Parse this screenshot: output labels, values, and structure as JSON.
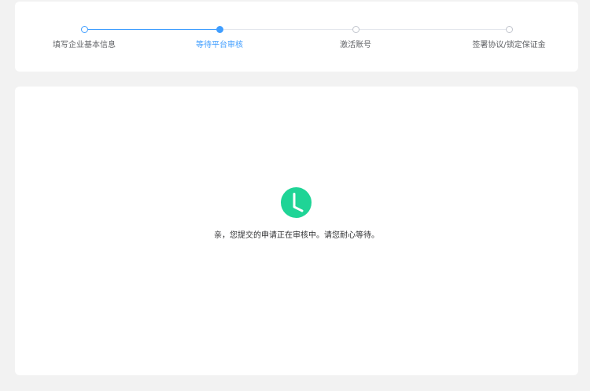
{
  "steps": [
    {
      "label": "填写企业基本信息",
      "state": "done"
    },
    {
      "label": "等待平台审核",
      "state": "active"
    },
    {
      "label": "激活账号",
      "state": "pending"
    },
    {
      "label": "签署协议/锁定保证金",
      "state": "pending"
    }
  ],
  "status": {
    "icon": "clock-icon",
    "icon_color": "#1fd496",
    "message": "亲，您提交的申请正在审核中。请您耐心等待。"
  },
  "colors": {
    "accent": "#409eff",
    "pending": "#c0c4cc"
  }
}
